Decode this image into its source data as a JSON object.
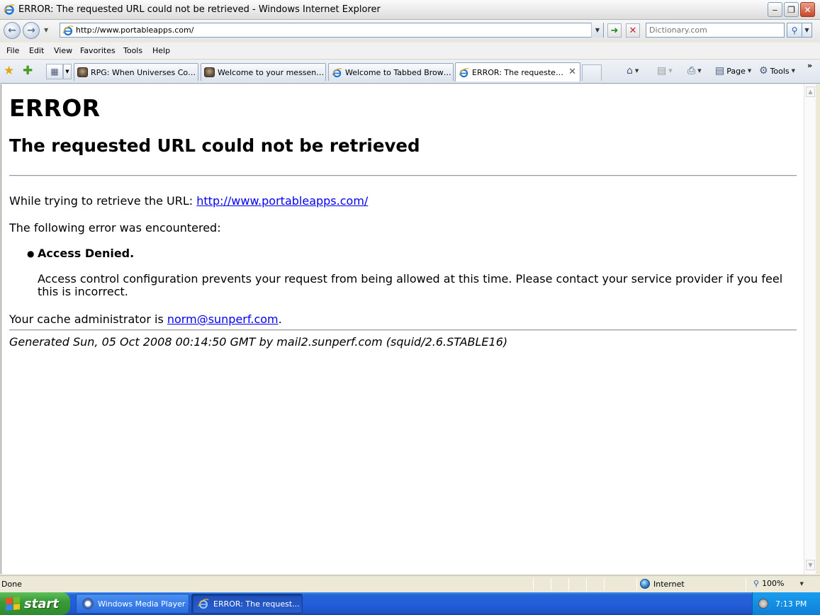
{
  "window": {
    "title": "ERROR: The requested URL could not be retrieved - Windows Internet Explorer",
    "min_glyph": "‒",
    "max_glyph": "❐",
    "close_glyph": "✕"
  },
  "address_bar": {
    "url": "http://www.portableapps.com/",
    "search_placeholder": "Dictionary.com"
  },
  "menu": [
    "File",
    "Edit",
    "View",
    "Favorites",
    "Tools",
    "Help"
  ],
  "tabs": [
    {
      "label": "RPG: When Universes Collide...",
      "icon": "game-icon"
    },
    {
      "label": "Welcome to your messenger",
      "icon": "game-icon"
    },
    {
      "label": "Welcome to Tabbed Browsing",
      "icon": "ie-icon"
    },
    {
      "label": "ERROR: The requested U...",
      "icon": "ie-icon",
      "active": true
    }
  ],
  "command_bar": {
    "page_label": "Page",
    "tools_label": "Tools"
  },
  "page": {
    "h1": "ERROR",
    "h2": "The requested URL could not be retrieved",
    "retrieve_prefix": "While trying to retrieve the URL: ",
    "retrieve_url": "http://www.portableapps.com/",
    "error_intro": "The following error was encountered:",
    "error_item": "Access Denied.",
    "error_detail": "Access control configuration prevents your request from being allowed at this time. Please contact your service provider if you feel this is incorrect.",
    "admin_prefix": "Your cache administrator is ",
    "admin_email": "norm@sunperf.com",
    "admin_suffix": ".",
    "generated": "Generated Sun, 05 Oct 2008 00:14:50 GMT by mail2.sunperf.com (squid/2.6.STABLE16)"
  },
  "status_bar": {
    "status": "Done",
    "zone": "Internet",
    "zoom": "100%"
  },
  "taskbar": {
    "start_label": "start",
    "items": [
      {
        "label": "Windows Media Player"
      },
      {
        "label": "ERROR: The request..."
      }
    ],
    "clock": "7:13 PM"
  },
  "colors": {
    "link": "#0000ee",
    "taskbar": "#245edb",
    "start_button": "#3a9c36"
  }
}
